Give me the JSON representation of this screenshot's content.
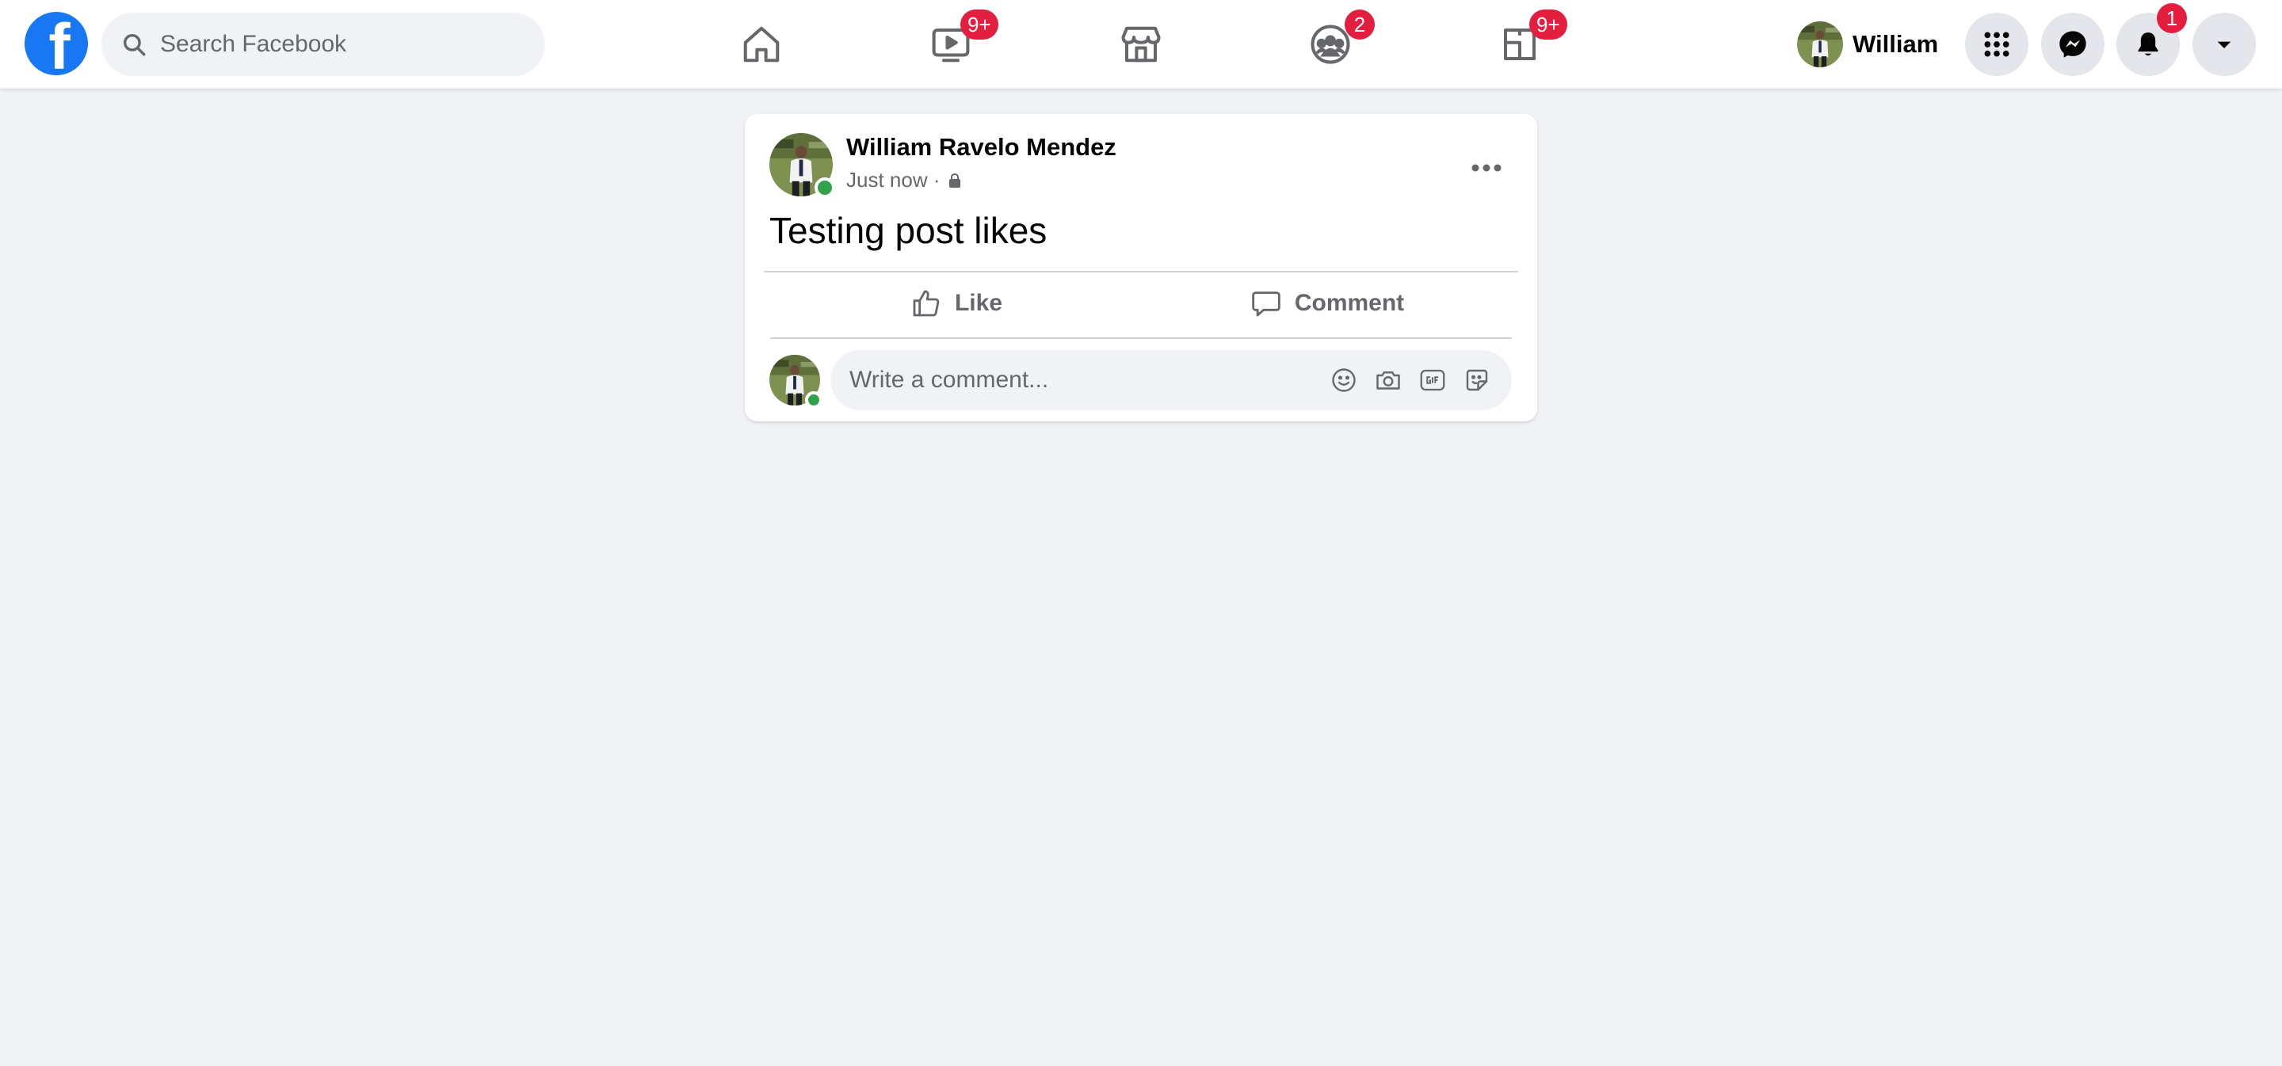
{
  "app": {
    "logo_letter": "f",
    "brand_color": "#1877f2"
  },
  "search": {
    "placeholder": "Search Facebook",
    "icon": "search-icon"
  },
  "nav_tabs": [
    {
      "name": "home",
      "icon": "home-icon",
      "badge": ""
    },
    {
      "name": "watch",
      "icon": "video-icon",
      "badge": "9+"
    },
    {
      "name": "marketplace",
      "icon": "marketplace-icon",
      "badge": ""
    },
    {
      "name": "groups",
      "icon": "groups-icon",
      "badge": "2"
    },
    {
      "name": "gaming",
      "icon": "gaming-icon",
      "badge": "9+"
    }
  ],
  "profile": {
    "short_name": "William"
  },
  "top_actions": [
    {
      "name": "menu",
      "icon": "grid-menu-icon",
      "badge": ""
    },
    {
      "name": "messenger",
      "icon": "messenger-icon",
      "badge": ""
    },
    {
      "name": "notifications",
      "icon": "bell-icon",
      "badge": "1"
    },
    {
      "name": "account",
      "icon": "caret-down-icon",
      "badge": ""
    }
  ],
  "post": {
    "author": "William Ravelo Mendez",
    "time": "Just now ·",
    "privacy_icon": "lock-icon",
    "text": "Testing post likes",
    "actions": {
      "like_label": "Like",
      "comment_label": "Comment"
    },
    "comment_box": {
      "placeholder": "Write a comment...",
      "icons": [
        "emoji-icon",
        "camera-icon",
        "gif-icon",
        "sticker-icon"
      ]
    }
  },
  "colors": {
    "badge": "#e41e3f",
    "online": "#31a24c",
    "page_bg": "#f0f2f5",
    "muted_text": "#65676b"
  }
}
